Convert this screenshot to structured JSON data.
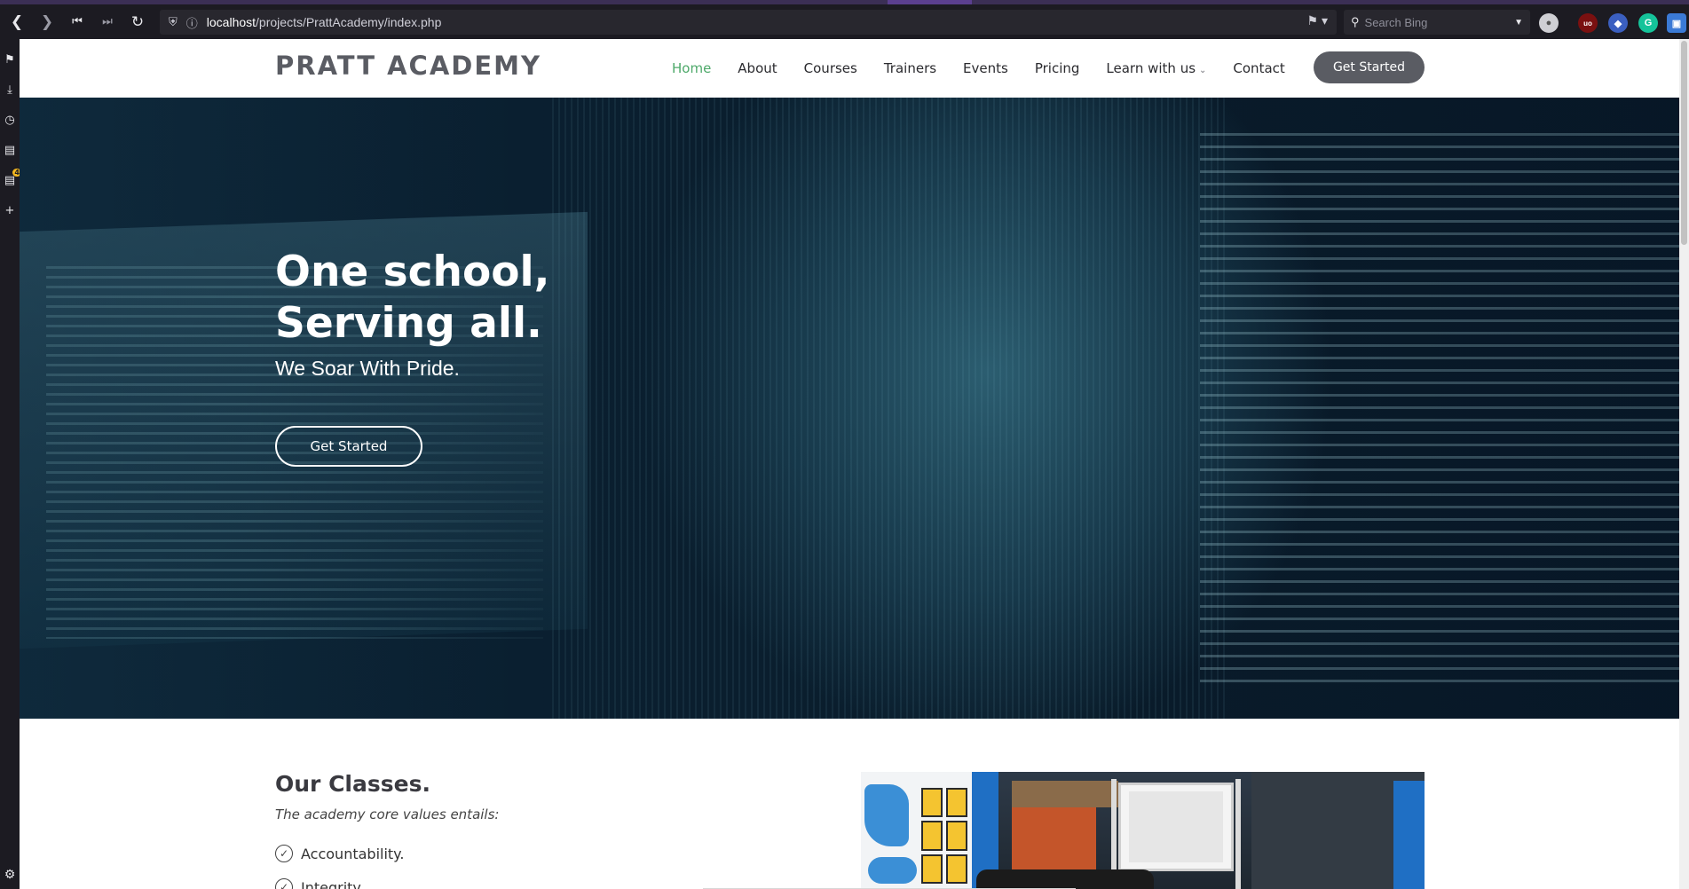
{
  "browser": {
    "url_host": "localhost",
    "url_path": "/projects/PrattAcademy/index.php",
    "search_placeholder": "Search Bing",
    "sidebar_badge": "4"
  },
  "header": {
    "logo": "PRATT ACADEMY",
    "nav": [
      {
        "label": "Home",
        "active": true
      },
      {
        "label": "About"
      },
      {
        "label": "Courses"
      },
      {
        "label": "Trainers"
      },
      {
        "label": "Events"
      },
      {
        "label": "Pricing"
      },
      {
        "label": "Learn with us",
        "dropdown": true
      },
      {
        "label": "Contact"
      }
    ],
    "cta_label": "Get Started"
  },
  "hero": {
    "title": "One school,\nServing all.",
    "subtitle": "We Soar With Pride.",
    "cta_label": "Get Started"
  },
  "classes": {
    "heading": "Our Classes.",
    "subheading": "The academy core values entails:",
    "values": [
      "Accountability.",
      "Integrity"
    ]
  },
  "colors": {
    "accent_green": "#4ea96a",
    "button_gray": "#5a5c63",
    "chrome_dark": "#1c1b22"
  },
  "icons": {
    "back": "back-icon",
    "forward": "forward-icon",
    "reload": "reload-icon",
    "home": "home-icon",
    "check": "check-circle-icon"
  }
}
